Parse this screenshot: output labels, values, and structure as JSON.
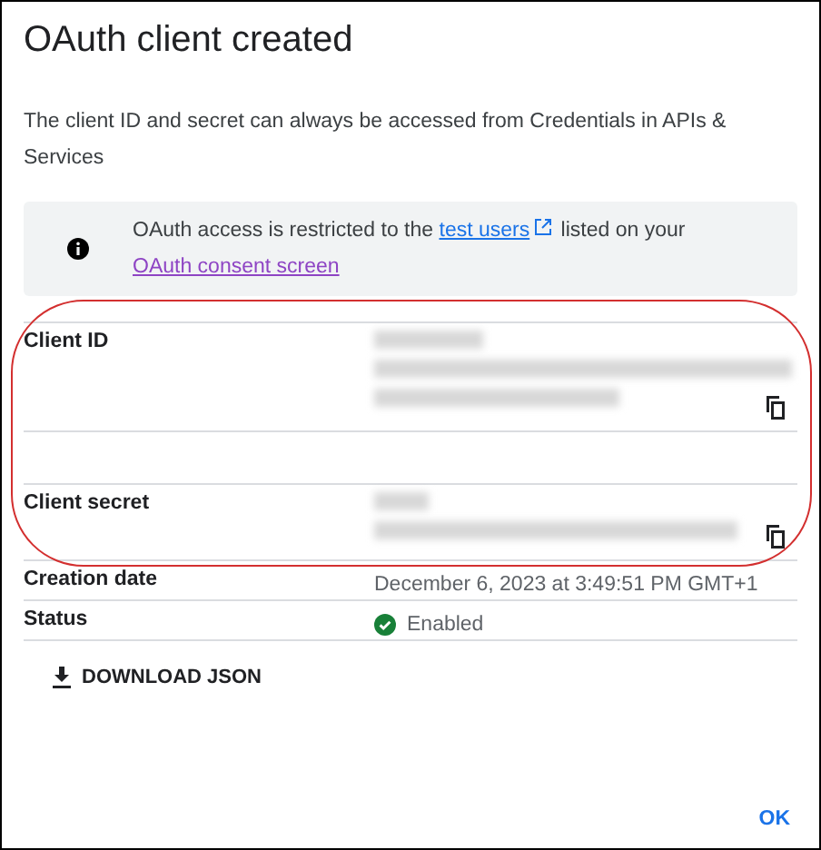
{
  "dialog": {
    "title": "OAuth client created",
    "description": "The client ID and secret can always be accessed from Credentials in APIs & Services"
  },
  "notice": {
    "before": "OAuth access is restricted to the ",
    "link": "test users",
    "middle": " listed on your",
    "link2": "OAuth consent screen"
  },
  "rows": [
    {
      "kind": "secret",
      "label": "Client ID"
    },
    {
      "kind": "blank"
    },
    {
      "kind": "secret",
      "label": "Client secret"
    },
    {
      "kind": "text",
      "label": "Creation date",
      "value": "December 6, 2023 at 3:49:51 PM GMT+1"
    },
    {
      "kind": "status",
      "label": "Status",
      "value": "Enabled",
      "enabled": true
    }
  ],
  "download_button": "DOWNLOAD JSON",
  "ok_button": "OK"
}
